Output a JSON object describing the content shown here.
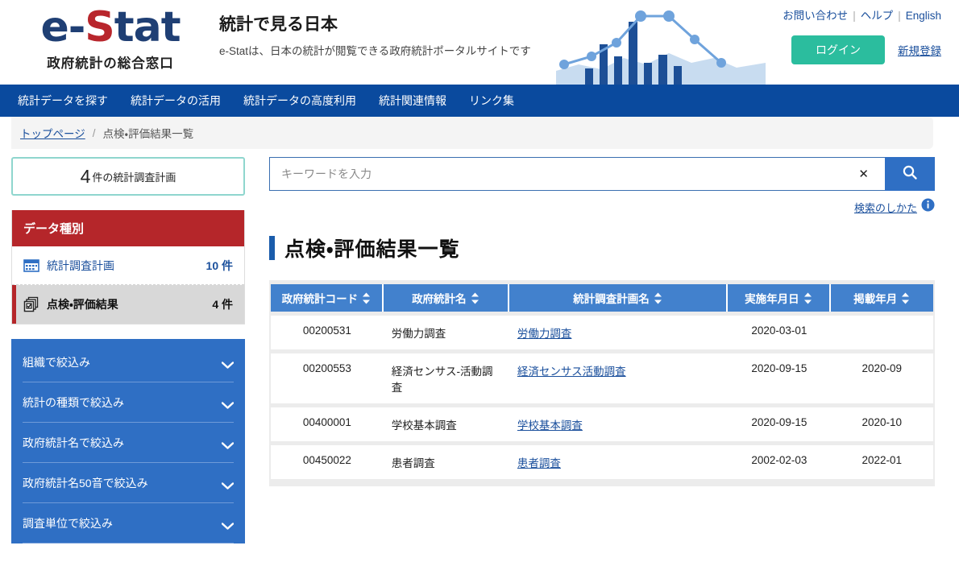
{
  "header": {
    "logo_main": "e-Stat",
    "logo_e": "e-",
    "logo_s": "S",
    "logo_tat": "tat",
    "logo_sub": "政府統計の総合窓口",
    "title": "統計で見る日本",
    "subtitle": "e-Statは、日本の統計が閲覧できる政府統計ポータルサイトです",
    "links": [
      {
        "label": "お問い合わせ",
        "name": "contact-link"
      },
      {
        "label": "ヘルプ",
        "name": "help-link"
      },
      {
        "label": "English",
        "name": "english-link"
      }
    ],
    "separator": "|",
    "login_label": "ログイン",
    "register_label": "新規登録",
    "colors": {
      "logo_blue": "#1f3f74",
      "logo_red": "#b8262c",
      "login_green": "#2bbd9e",
      "nav_blue": "#0a4a9e"
    }
  },
  "global_nav": [
    {
      "label": "統計データを探す",
      "name": "gnav-search-data"
    },
    {
      "label": "統計データの活用",
      "name": "gnav-use-data"
    },
    {
      "label": "統計データの高度利用",
      "name": "gnav-advanced-use"
    },
    {
      "label": "統計関連情報",
      "name": "gnav-related-info"
    },
    {
      "label": "リンク集",
      "name": "gnav-links"
    }
  ],
  "breadcrumb": {
    "home": "トップページ",
    "slash": "/",
    "current": "点検・評価結果一覧"
  },
  "sidebar": {
    "count_box": {
      "number": "4",
      "label": "件の統計調査計画"
    },
    "datatype": {
      "heading": "データ種別",
      "items": [
        {
          "label": "統計調査計画",
          "count": "10 件",
          "icon": "calendar-table-icon",
          "active": false
        },
        {
          "label": "点検・評価結果",
          "count": "4 件",
          "icon": "documents-stack-icon",
          "active": true
        }
      ]
    },
    "filters": [
      {
        "label": "組織で絞込み",
        "name": "filter-organization"
      },
      {
        "label": "統計の種類で絞込み",
        "name": "filter-stat-type"
      },
      {
        "label": "政府統計名で絞込み",
        "name": "filter-stat-name"
      },
      {
        "label": "政府統計名50音で絞込み",
        "name": "filter-stat-name-kana"
      },
      {
        "label": "調査単位で絞込み",
        "name": "filter-survey-unit"
      }
    ]
  },
  "search": {
    "placeholder": "キーワードを入力",
    "value": "",
    "clear_label": "✕",
    "search_icon": "magnifier-icon",
    "howto_label": "検索のしかた",
    "info_icon": "info-icon"
  },
  "main": {
    "page_title": "点検・評価結果一覧",
    "table": {
      "columns": [
        {
          "label": "政府統計コード",
          "name": "col-gov-stat-code",
          "sortable": true
        },
        {
          "label": "政府統計名",
          "name": "col-gov-stat-name",
          "sortable": true
        },
        {
          "label": "統計調査計画名",
          "name": "col-survey-plan-name",
          "sortable": true
        },
        {
          "label": "実施年月日",
          "name": "col-implementation-date",
          "sortable": true
        },
        {
          "label": "掲載年月",
          "name": "col-publication-date",
          "sortable": true
        }
      ],
      "rows": [
        {
          "code": "00200531",
          "stat_name": "労働力調査",
          "plan_name": "労働力調査",
          "impl_date": "2020-03-01",
          "pub_date": ""
        },
        {
          "code": "00200553",
          "stat_name": "経済センサス-活動調査",
          "plan_name": "経済センサス活動調査",
          "impl_date": "2020-09-15",
          "pub_date": "2020-09"
        },
        {
          "code": "00400001",
          "stat_name": "学校基本調査",
          "plan_name": "学校基本調査",
          "impl_date": "2020-09-15",
          "pub_date": "2020-10"
        },
        {
          "code": "00450022",
          "stat_name": "患者調査",
          "plan_name": "患者調査",
          "impl_date": "2002-02-03",
          "pub_date": "2022-01"
        }
      ]
    }
  }
}
